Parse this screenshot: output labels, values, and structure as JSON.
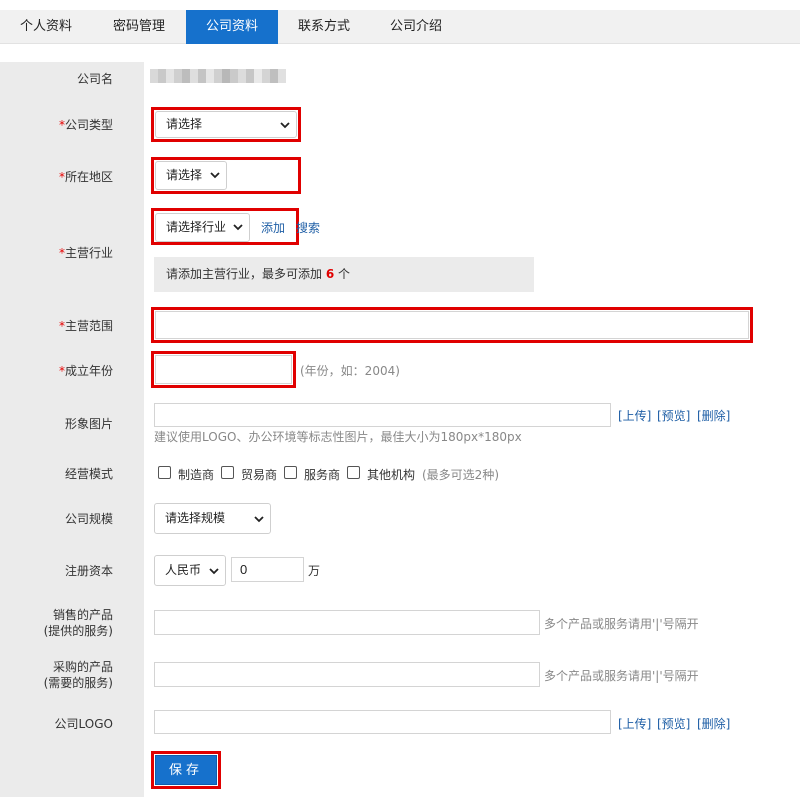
{
  "tabs": [
    {
      "label": "个人资料",
      "active": false
    },
    {
      "label": "密码管理",
      "active": false
    },
    {
      "label": "公司资料",
      "active": true
    },
    {
      "label": "联系方式",
      "active": false
    },
    {
      "label": "公司介绍",
      "active": false
    }
  ],
  "form": {
    "company_name_label": "公司名",
    "company_type": {
      "label": "公司类型",
      "required_mark": "*",
      "value": "请选择"
    },
    "location": {
      "label": "所在地区",
      "required_mark": "*",
      "value": "请选择"
    },
    "industry": {
      "label": "主营行业",
      "required_mark": "*",
      "value": "请选择行业",
      "add_link": "添加",
      "search_link": "搜索",
      "info_prefix": "请添加主营行业，最多可添加 ",
      "info_count": "6",
      "info_suffix": " 个"
    },
    "business_scope": {
      "label": "主营范围",
      "required_mark": "*",
      "value": ""
    },
    "founded_year": {
      "label": "成立年份",
      "required_mark": "*",
      "value": "",
      "hint": "(年份，如：2004)"
    },
    "image": {
      "label": "形象图片",
      "value": "",
      "upload": "[上传]",
      "preview": "[预览]",
      "delete": "[删除]",
      "hint": "建议使用LOGO、办公环境等标志性图片，最佳大小为180px*180px"
    },
    "business_mode": {
      "label": "经营模式",
      "options": [
        "制造商",
        "贸易商",
        "服务商",
        "其他机构"
      ],
      "hint": "(最多可选2种)"
    },
    "company_size": {
      "label": "公司规模",
      "value": "请选择规模"
    },
    "registered_capital": {
      "label": "注册资本",
      "currency": "人民币",
      "amount": "0",
      "unit": "万"
    },
    "sell_products": {
      "label_line1": "销售的产品",
      "label_line2": "(提供的服务)",
      "value": "",
      "hint": "多个产品或服务请用'|'号隔开"
    },
    "buy_products": {
      "label_line1": "采购的产品",
      "label_line2": "(需要的服务)",
      "value": "",
      "hint": "多个产品或服务请用'|'号隔开"
    },
    "logo": {
      "label": "公司LOGO",
      "value": "",
      "upload": "[上传]",
      "preview": "[预览]",
      "delete": "[删除]"
    },
    "save_label": "保存"
  },
  "colors": {
    "accent": "#1671cc",
    "highlight_border": "#e00000",
    "required": "#e60000"
  }
}
